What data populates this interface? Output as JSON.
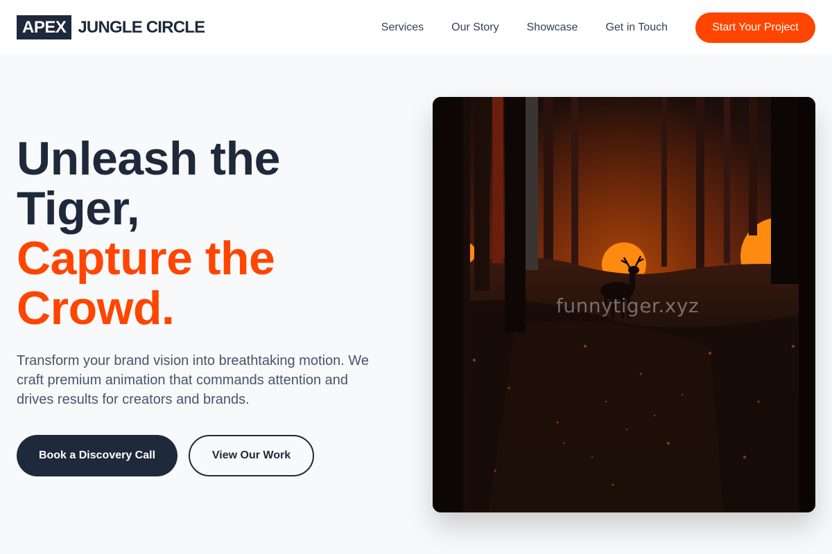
{
  "brand": {
    "box_text": "APEX",
    "name": "JUNGLE CIRCLE"
  },
  "nav": {
    "links": [
      "Services",
      "Our Story",
      "Showcase",
      "Get in Touch"
    ],
    "cta": "Start Your Project"
  },
  "hero": {
    "headline_line1": "Unleash the",
    "headline_line2": "Tiger,",
    "headline_accent1": "Capture the",
    "headline_accent2": "Crowd.",
    "subtitle": "Transform your brand vision into breathtaking motion. We craft premium animation that commands attention and drives results for creators and brands.",
    "primary_button": "Book a Discovery Call",
    "secondary_button": "View Our Work",
    "image_watermark": "funnytiger.xyz"
  },
  "colors": {
    "accent": "#ff4500",
    "dark": "#1e293b",
    "text_muted": "#475569",
    "background": "#f8f9fa"
  }
}
